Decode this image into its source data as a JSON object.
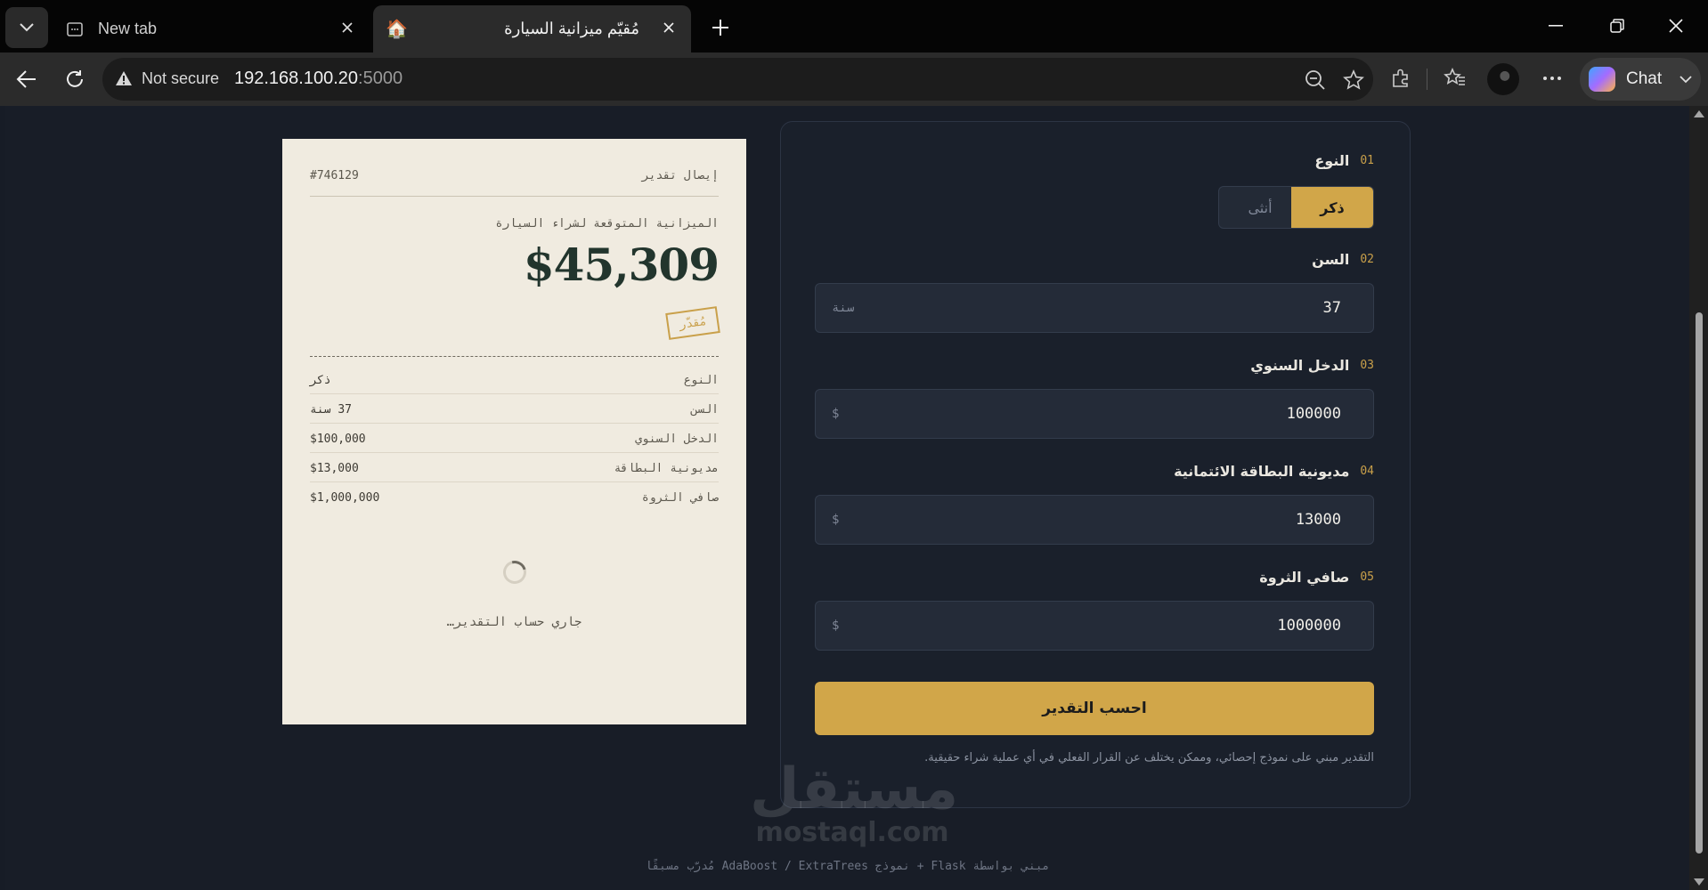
{
  "browser": {
    "tabs": [
      {
        "title": "New tab",
        "active": false
      },
      {
        "title": "مُقيّم ميزانية السيارة",
        "active": true,
        "favicon": "🏠"
      }
    ],
    "address": {
      "security_label": "Not secure",
      "host": "192.168.100.20",
      "port": ":5000"
    },
    "chat_label": "Chat"
  },
  "receipt": {
    "label": "إيصال تقدير",
    "id": "#746129",
    "subtitle": "الميزانية المتوقعة لشراء السيارة",
    "amount": "$45,309",
    "stamp": "مُقدّر",
    "rows": [
      {
        "key": "النوع",
        "value": "ذكر"
      },
      {
        "key": "السن",
        "value": "37 سنة"
      },
      {
        "key": "الدخل السنوي",
        "value": "$100,000"
      },
      {
        "key": "مديونية البطاقة",
        "value": "$13,000"
      },
      {
        "key": "صافي الثروة",
        "value": "$1,000,000"
      }
    ],
    "loading_text": "جاري حساب التقدير…"
  },
  "form": {
    "fields": [
      {
        "num": "01",
        "label": "النوع"
      },
      {
        "num": "02",
        "label": "السن",
        "value": "37",
        "unit": "سنة"
      },
      {
        "num": "03",
        "label": "الدخل السنوي",
        "value": "100000",
        "unit": "$"
      },
      {
        "num": "04",
        "label": "مديونية البطاقة الائتمانية",
        "value": "13000",
        "unit": "$"
      },
      {
        "num": "05",
        "label": "صافي الثروة",
        "value": "1000000",
        "unit": "$"
      }
    ],
    "gender_options": {
      "male": "ذكر",
      "female": "أنثى",
      "selected": "male"
    },
    "submit_label": "احسب التقدير",
    "disclaimer": "التقدير مبني على نموذج إحصائي، وممكن يختلف عن القرار الفعلي في أي عملية شراء حقيقية."
  },
  "footer": "مبني بواسطة Flask + نموذج AdaBoost / ExtraTrees مُدرّب مسبقًا",
  "watermark": {
    "arabic": "مستقل",
    "latin": "mostaql.com"
  },
  "colors": {
    "accent": "#d1a649",
    "background": "#181d27",
    "receipt": "#f0ebe0"
  }
}
